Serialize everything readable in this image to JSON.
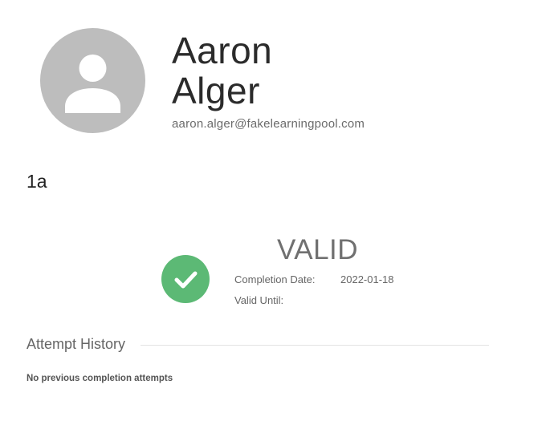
{
  "profile": {
    "first_name": "Aaron",
    "last_name": "Alger",
    "email": "aaron.alger@fakelearningpool.com",
    "avatar_icon": "user-avatar-icon"
  },
  "course": {
    "code": "1a"
  },
  "certification": {
    "status": "VALID",
    "status_icon": "check-circle-icon",
    "status_color": "#5cb975",
    "completion_label": "Completion Date:",
    "completion_value": "2022-01-18",
    "valid_until_label": "Valid Until:",
    "valid_until_value": ""
  },
  "attempt_history": {
    "title": "Attempt History",
    "empty_message": "No previous completion attempts"
  }
}
